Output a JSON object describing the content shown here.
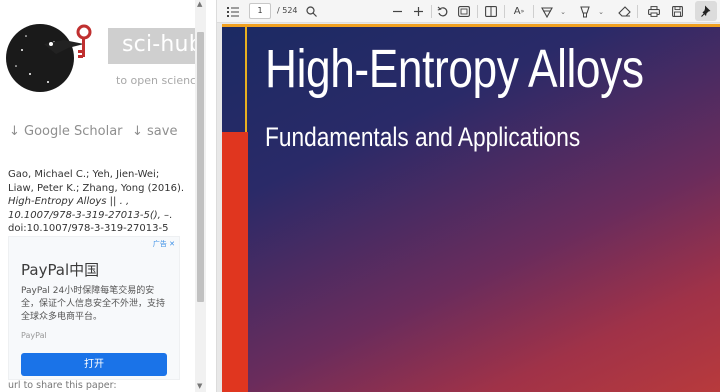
{
  "scihub": {
    "title": "sci-hub",
    "tagline": "to open science",
    "actions": {
      "scholar": "↓ Google Scholar",
      "save": "↓ save"
    },
    "citation": {
      "authors": "Gao, Michael C.; Yeh, Jien-Wei; Liaw, Peter K.; Zhang, Yong (2016).",
      "title": "High-Entropy Alloys || . , 10.1007/978-3-319-27013-5(),",
      "tail": "–. doi:10.1007/978-3-319-27013-5"
    },
    "share_label": "url to share this paper:"
  },
  "ad": {
    "badge": "广告",
    "title": "PayPal中国",
    "description": "PayPal 24小时保障每笔交易的安全，保证个人信息安全不外泄，支持全球众多电商平台。",
    "brand": "PayPal",
    "button": "打开"
  },
  "pdf": {
    "page_current": "1",
    "page_total": "/ 524",
    "toolbar_icons": [
      "contents-icon",
      "search-icon",
      "zoom-out-icon",
      "zoom-in-icon",
      "rotate-icon",
      "fit-page-icon",
      "two-page-icon",
      "read-aloud-icon",
      "draw-icon",
      "highlight-icon",
      "eraser-icon",
      "print-icon",
      "save-icon",
      "pin-icon"
    ]
  },
  "cover": {
    "title": "High-Entropy Alloys",
    "subtitle": "Fundamentals and Applications"
  },
  "colors": {
    "accent_blue": "#1a73e8",
    "cover_red": "#e0361f",
    "cover_navy": "#1b2a63"
  }
}
